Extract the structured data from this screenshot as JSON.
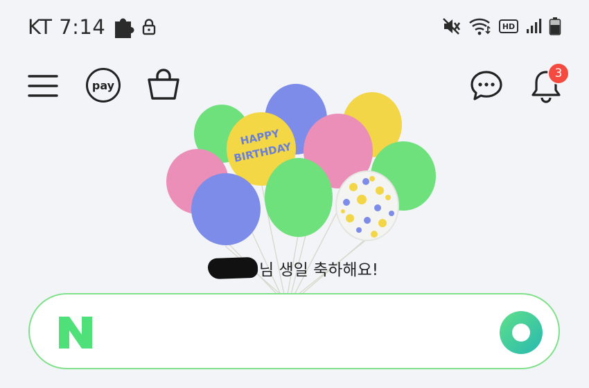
{
  "status_bar": {
    "carrier": "KT",
    "time": "7:14",
    "left_icons": [
      "puzzle-icon",
      "lock-icon"
    ],
    "right_icons": [
      "mute-icon",
      "wifi-icon",
      "hd-icon",
      "signal-icon",
      "battery-icon"
    ],
    "hd_label": "HD"
  },
  "top_nav": {
    "menu_icon": "hamburger-menu-icon",
    "pay_label": "pay",
    "shopping_icon": "shopping-bag-icon",
    "talk_icon": "chat-bubble-icon",
    "notification_icon": "bell-icon",
    "notification_count": "3",
    "badge_color": "#f44a3f"
  },
  "birthday": {
    "balloon_text_line1": "HAPPY",
    "balloon_text_line2": "BIRTHDAY",
    "greeting": "님 생일 축하해요!",
    "name_redacted": true
  },
  "search": {
    "logo": "N",
    "logo_color": "#4fe07a",
    "greendot_icon": "greendot-icon",
    "border_color": "#7fe08a"
  }
}
